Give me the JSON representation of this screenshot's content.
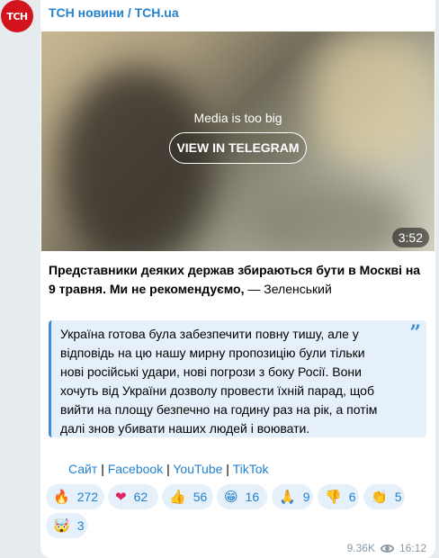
{
  "channel": {
    "avatar_text": "ТСН",
    "name": "ТСН новини / TCH.ua"
  },
  "media": {
    "notice": "Media is too big",
    "button_label": "VIEW IN TELEGRAM",
    "duration": "3:52"
  },
  "post": {
    "headline_bold": "Представники деяких держав збираються бути в Москві на 9 травня. Ми не рекомендуємо,",
    "headline_rest": " — Зеленський",
    "quote_lines": [
      "Україна готова була забезпечити повну тишу, але у",
      "відповідь на цю нашу мирну пропозицію були тільки",
      "нові російські удари, нові погрози з боку Росії. Вони",
      "хочуть від України дозволу провести їхній парад, щоб",
      "вийти на площу безпечно на годину раз на рік, а потім",
      "далі знов убивати наших людей і воювати."
    ],
    "quote_icon": "”"
  },
  "links": {
    "items": [
      "Сайт",
      "Facebook",
      "YouTube",
      "TikTok"
    ],
    "separator": "|"
  },
  "reactions": [
    {
      "emoji": "🔥",
      "icon": "fire-icon",
      "count": "272"
    },
    {
      "emoji": "❤",
      "icon": "heart-icon",
      "count": "62"
    },
    {
      "emoji": "👍",
      "icon": "thumbs-up-icon",
      "count": "56"
    },
    {
      "emoji": "😁",
      "icon": "grin-icon",
      "count": "16"
    },
    {
      "emoji": "🙏",
      "icon": "pray-icon",
      "count": "9"
    },
    {
      "emoji": "👎",
      "icon": "thumbs-down-icon",
      "count": "6"
    },
    {
      "emoji": "👏",
      "icon": "clap-icon",
      "count": "5"
    },
    {
      "emoji": "🤯",
      "icon": "mind-blown-icon",
      "count": "3"
    }
  ],
  "meta": {
    "views": "9.36K",
    "time": "16:12"
  },
  "colors": {
    "accent": "#2481cc",
    "brand_red": "#d4141d",
    "quote_bg": "#e6f0fa"
  }
}
